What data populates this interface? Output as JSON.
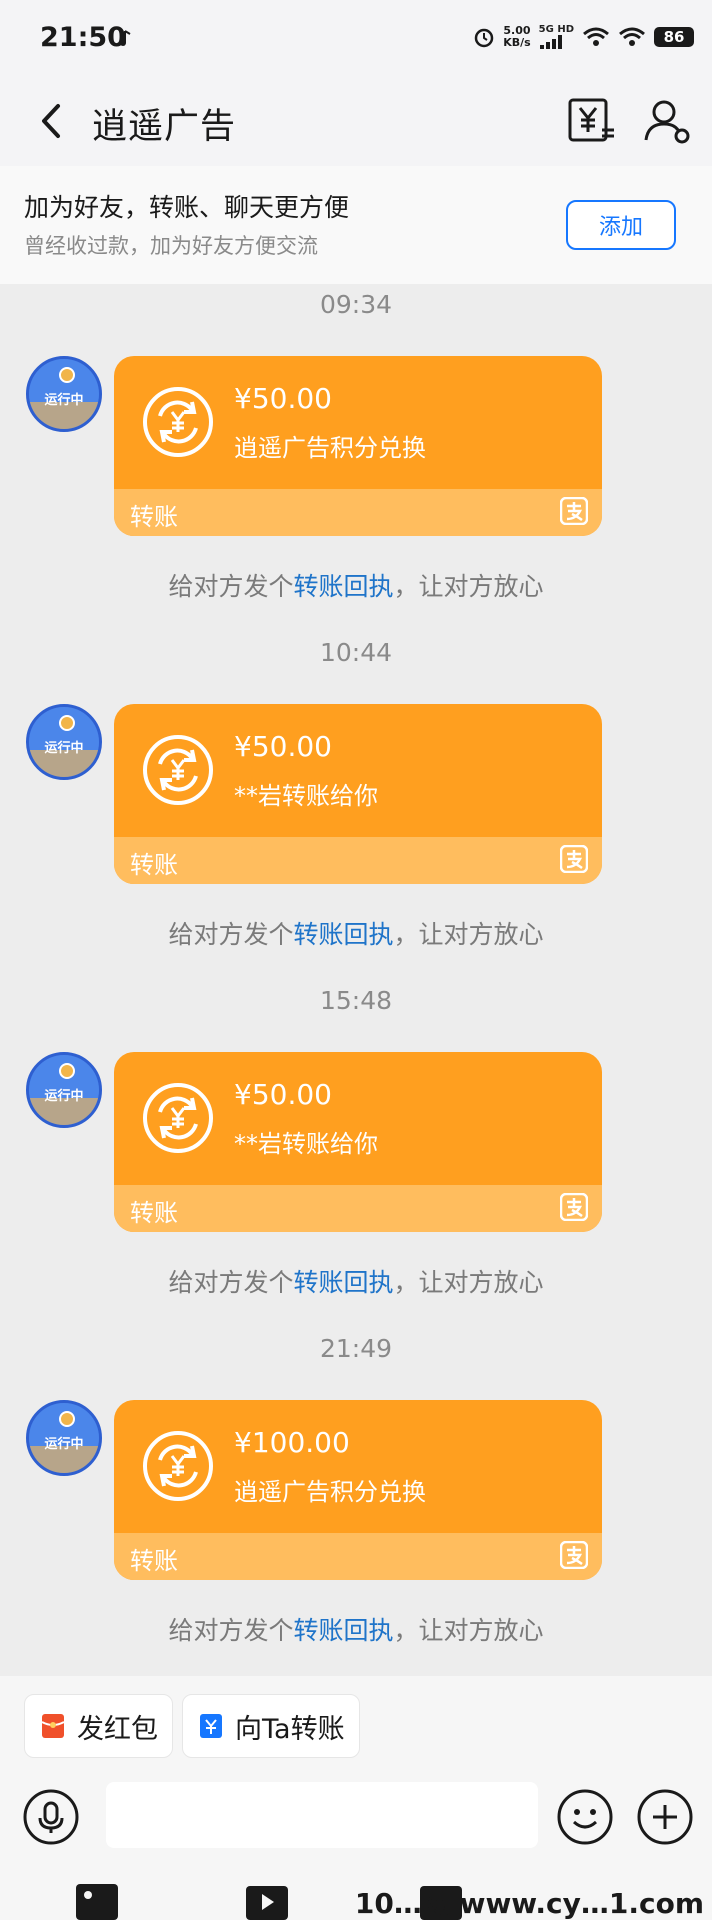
{
  "status_bar": {
    "time": "21:50",
    "net_speed_value": "5.00",
    "net_speed_unit": "KB/s",
    "network": "5G HD",
    "battery": "86"
  },
  "header": {
    "title": "逍遥广告"
  },
  "friend_banner": {
    "title": "加为好友，转账、聊天更方便",
    "subtitle": "曾经收过款，加为好友方便交流",
    "add_label": "添加"
  },
  "messages": [
    {
      "time": "09:34",
      "amount": "¥50.00",
      "memo": "逍遥广告积分兑换",
      "card_label": "转账",
      "receipt_prefix": "给对方发个",
      "receipt_link": "转账回执",
      "receipt_suffix": "，让对方放心"
    },
    {
      "time": "10:44",
      "amount": "¥50.00",
      "memo": "**岩转账给你",
      "card_label": "转账",
      "receipt_prefix": "给对方发个",
      "receipt_link": "转账回执",
      "receipt_suffix": "，让对方放心"
    },
    {
      "time": "15:48",
      "amount": "¥50.00",
      "memo": "**岩转账给你",
      "card_label": "转账",
      "receipt_prefix": "给对方发个",
      "receipt_link": "转账回执",
      "receipt_suffix": "，让对方放心"
    },
    {
      "time": "21:49",
      "amount": "¥100.00",
      "memo": "逍遥广告积分兑换",
      "card_label": "转账",
      "receipt_prefix": "给对方发个",
      "receipt_link": "转账回执",
      "receipt_suffix": "，让对方放心"
    }
  ],
  "avatar_label": "运行中",
  "quick_actions": [
    {
      "label": "发红包",
      "icon": "red-packet-icon"
    },
    {
      "label": "向Ta转账",
      "icon": "transfer-icon"
    }
  ],
  "input": {
    "placeholder": ""
  },
  "watermark": "10…网 www.cy…1.com",
  "colors": {
    "card": "#ff9f1f",
    "card_footer": "#ffbd5e",
    "link": "#1f74c9",
    "accent": "#1677ff"
  }
}
